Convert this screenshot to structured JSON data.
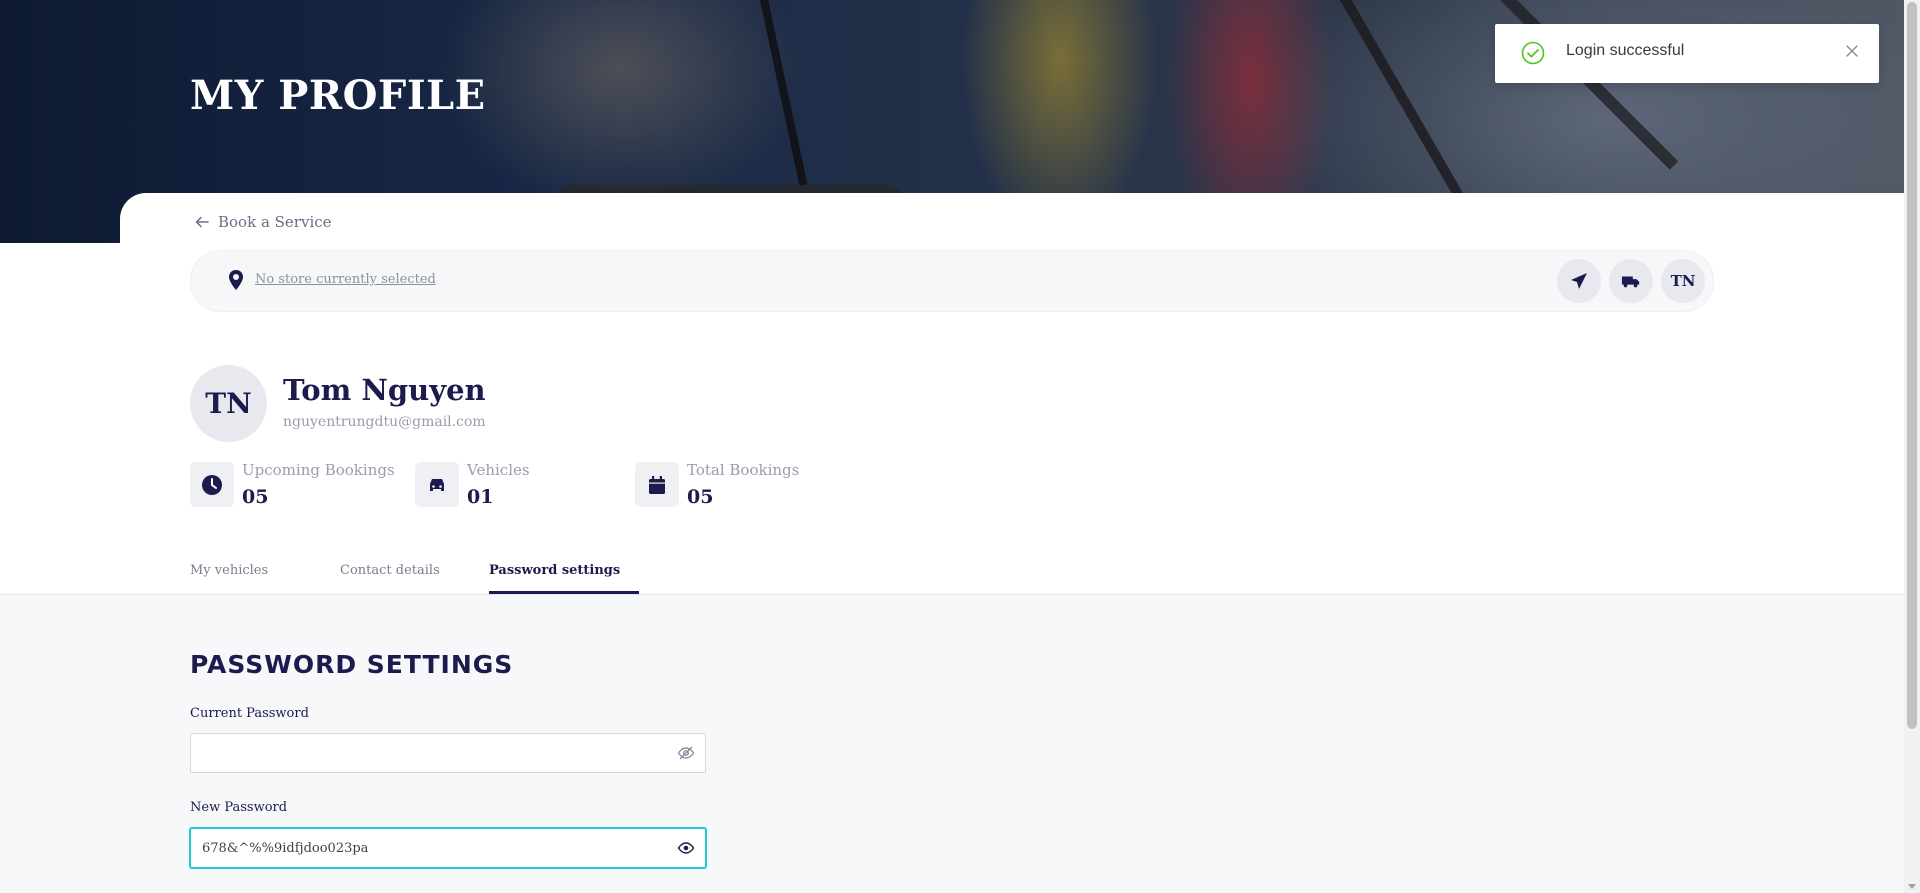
{
  "hero": {
    "title": "MY PROFILE"
  },
  "nav": {
    "back_label": "Book a Service"
  },
  "store": {
    "text": "No store currently selected",
    "actions": [
      {
        "icon": "paper-plane-icon"
      },
      {
        "icon": "truck-icon"
      },
      {
        "label": "TN"
      }
    ]
  },
  "profile": {
    "initials": "TN",
    "name": "Tom Nguyen",
    "email": "nguyentrungdtu@gmail.com",
    "stats": [
      {
        "icon": "clock-icon",
        "label": "Upcoming Bookings",
        "value": "05"
      },
      {
        "icon": "car-icon",
        "label": "Vehicles",
        "value": "01"
      },
      {
        "icon": "calendar-icon",
        "label": "Total Bookings",
        "value": "05"
      }
    ]
  },
  "tabs": [
    {
      "label": "My vehicles",
      "active": false
    },
    {
      "label": "Contact details",
      "active": false
    },
    {
      "label": "Password settings",
      "active": true
    }
  ],
  "password_settings": {
    "title": "PASSWORD SETTINGS",
    "current_password": {
      "label": "Current Password",
      "value": "",
      "eye_icon": "eye-slash-icon"
    },
    "new_password": {
      "label": "New Password",
      "value": "678&^%%9idfjdoo023pa",
      "eye_icon": "eye-icon"
    }
  },
  "toast": {
    "message": "Login successful",
    "icon": "check-circle-icon",
    "status_color": "#52c41a"
  },
  "colors": {
    "brand_navy": "#1d1a4d",
    "focus_cyan": "#1ec8d5"
  }
}
